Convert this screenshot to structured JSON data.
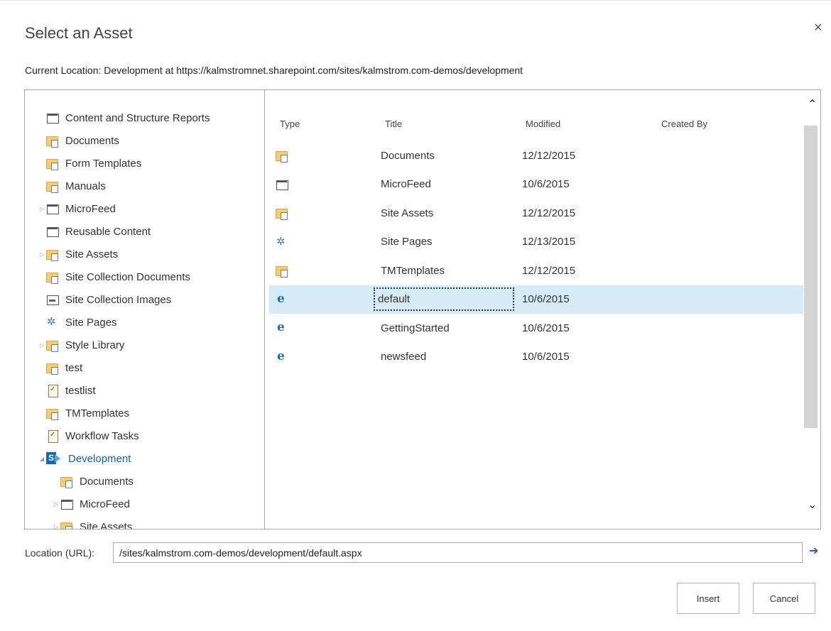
{
  "dialog": {
    "title": "Select an Asset",
    "close_glyph": "×",
    "current_location": "Current Location: Development at https://kalmstromnet.sharepoint.com/sites/kalmstrom.com-demos/development"
  },
  "tree": {
    "items": [
      {
        "label": "Content and Structure Reports",
        "icon": "list-icon",
        "expander": ""
      },
      {
        "label": "Documents",
        "icon": "folder-icon",
        "expander": ""
      },
      {
        "label": "Form Templates",
        "icon": "folder-icon",
        "expander": ""
      },
      {
        "label": "Manuals",
        "icon": "folder-icon",
        "expander": ""
      },
      {
        "label": "MicroFeed",
        "icon": "list-icon",
        "expander": "▷"
      },
      {
        "label": "Reusable Content",
        "icon": "list-icon",
        "expander": ""
      },
      {
        "label": "Site Assets",
        "icon": "folder-icon",
        "expander": "▷"
      },
      {
        "label": "Site Collection Documents",
        "icon": "folder-icon",
        "expander": ""
      },
      {
        "label": "Site Collection Images",
        "icon": "image-icon",
        "expander": ""
      },
      {
        "label": "Site Pages",
        "icon": "site-pages-icon",
        "expander": ""
      },
      {
        "label": "Style Library",
        "icon": "folder-icon",
        "expander": "▷"
      },
      {
        "label": "test",
        "icon": "folder-icon",
        "expander": ""
      },
      {
        "label": "testlist",
        "icon": "task-icon",
        "expander": ""
      },
      {
        "label": "TMTemplates",
        "icon": "folder-icon",
        "expander": ""
      },
      {
        "label": "Workflow Tasks",
        "icon": "task-icon",
        "expander": ""
      },
      {
        "label": "Development",
        "icon": "sharepoint-icon",
        "expander": "◢"
      },
      {
        "label": "Documents",
        "icon": "folder-icon",
        "expander": ""
      },
      {
        "label": "MicroFeed",
        "icon": "list-icon",
        "expander": "▷"
      },
      {
        "label": "Site Assets",
        "icon": "folder-icon",
        "expander": "▷"
      }
    ]
  },
  "list": {
    "columns": {
      "type": "Type",
      "title": "Title",
      "modified": "Modified",
      "created_by": "Created By"
    },
    "rows": [
      {
        "icon": "folder-icon",
        "title": "Documents",
        "modified": "12/12/2015",
        "created_by": ""
      },
      {
        "icon": "list-icon",
        "title": "MicroFeed",
        "modified": "10/6/2015",
        "created_by": ""
      },
      {
        "icon": "folder-icon",
        "title": "Site Assets",
        "modified": "12/12/2015",
        "created_by": ""
      },
      {
        "icon": "site-pages-icon",
        "title": "Site Pages",
        "modified": "12/13/2015",
        "created_by": ""
      },
      {
        "icon": "folder-icon",
        "title": "TMTemplates",
        "modified": "12/12/2015",
        "created_by": ""
      },
      {
        "icon": "aspx-page-icon",
        "title": "default",
        "modified": "10/6/2015",
        "created_by": "",
        "selected": true
      },
      {
        "icon": "aspx-page-icon",
        "title": "GettingStarted",
        "modified": "10/6/2015",
        "created_by": ""
      },
      {
        "icon": "aspx-page-icon",
        "title": "newsfeed",
        "modified": "10/6/2015",
        "created_by": ""
      }
    ],
    "scroll_up_glyph": "⌃",
    "scroll_down_glyph": "⌄"
  },
  "location": {
    "label": "Location (URL):",
    "value": "/sites/kalmstrom.com-demos/development/default.aspx",
    "go_glyph": "➔"
  },
  "buttons": {
    "insert": "Insert",
    "cancel": "Cancel"
  }
}
